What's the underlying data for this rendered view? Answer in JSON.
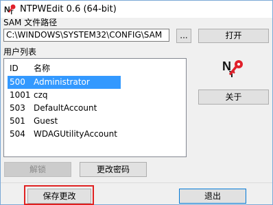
{
  "window": {
    "title": "NTPWEdit 0.6 (64-bit)"
  },
  "sam": {
    "label": "SAM 文件路径",
    "path": "C:\\WINDOWS\\SYSTEM32\\CONFIG\\SAM",
    "browse_label": "...",
    "open_label": "打开"
  },
  "users": {
    "label": "用户列表",
    "columns": [
      "ID",
      "名称"
    ],
    "rows": [
      {
        "id": "500",
        "name": "Administrator",
        "selected": true
      },
      {
        "id": "1001",
        "name": "czq",
        "selected": false
      },
      {
        "id": "503",
        "name": "DefaultAccount",
        "selected": false
      },
      {
        "id": "501",
        "name": "Guest",
        "selected": false
      },
      {
        "id": "504",
        "name": "WDAGUtilityAccount",
        "selected": false
      }
    ]
  },
  "actions": {
    "unlock_label": "解锁",
    "change_password_label": "更改密码",
    "about_label": "关于",
    "save_label": "保存更改",
    "exit_label": "退出"
  },
  "colors": {
    "selection": "#3399ff",
    "highlight_box": "#e02020",
    "focus_border": "#0078d7"
  }
}
